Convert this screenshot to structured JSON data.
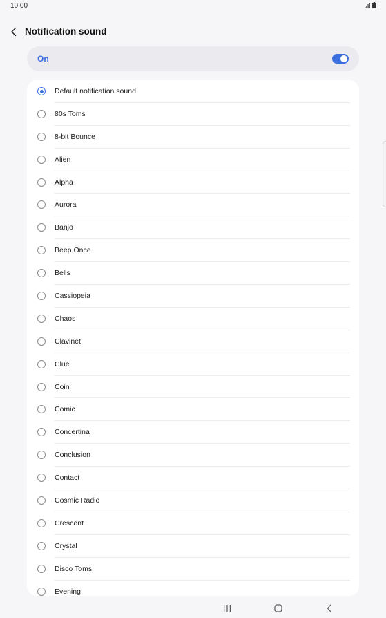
{
  "status_bar": {
    "time": "10:00",
    "icons": [
      "signal-icon",
      "battery-icon"
    ]
  },
  "header": {
    "back_icon": "chevron-left-icon",
    "title": "Notification sound"
  },
  "master_switch": {
    "label": "On",
    "enabled": true
  },
  "sounds": [
    {
      "label": "Default notification sound",
      "selected": true
    },
    {
      "label": "80s Toms",
      "selected": false
    },
    {
      "label": "8-bit Bounce",
      "selected": false
    },
    {
      "label": "Alien",
      "selected": false
    },
    {
      "label": "Alpha",
      "selected": false
    },
    {
      "label": "Aurora",
      "selected": false
    },
    {
      "label": "Banjo",
      "selected": false
    },
    {
      "label": "Beep Once",
      "selected": false
    },
    {
      "label": "Bells",
      "selected": false
    },
    {
      "label": "Cassiopeia",
      "selected": false
    },
    {
      "label": "Chaos",
      "selected": false
    },
    {
      "label": "Clavinet",
      "selected": false
    },
    {
      "label": "Clue",
      "selected": false
    },
    {
      "label": "Coin",
      "selected": false
    },
    {
      "label": "Comic",
      "selected": false
    },
    {
      "label": "Concertina",
      "selected": false
    },
    {
      "label": "Conclusion",
      "selected": false
    },
    {
      "label": "Contact",
      "selected": false
    },
    {
      "label": "Cosmic Radio",
      "selected": false
    },
    {
      "label": "Crescent",
      "selected": false
    },
    {
      "label": "Crystal",
      "selected": false
    },
    {
      "label": "Disco Toms",
      "selected": false
    },
    {
      "label": "Evening",
      "selected": false
    }
  ],
  "nav_bar": {
    "icons": [
      "recent-apps-icon",
      "home-icon",
      "back-icon"
    ]
  },
  "colors": {
    "accent": "#3b6fe0",
    "background": "#f6f6f8",
    "card": "#ffffff"
  }
}
